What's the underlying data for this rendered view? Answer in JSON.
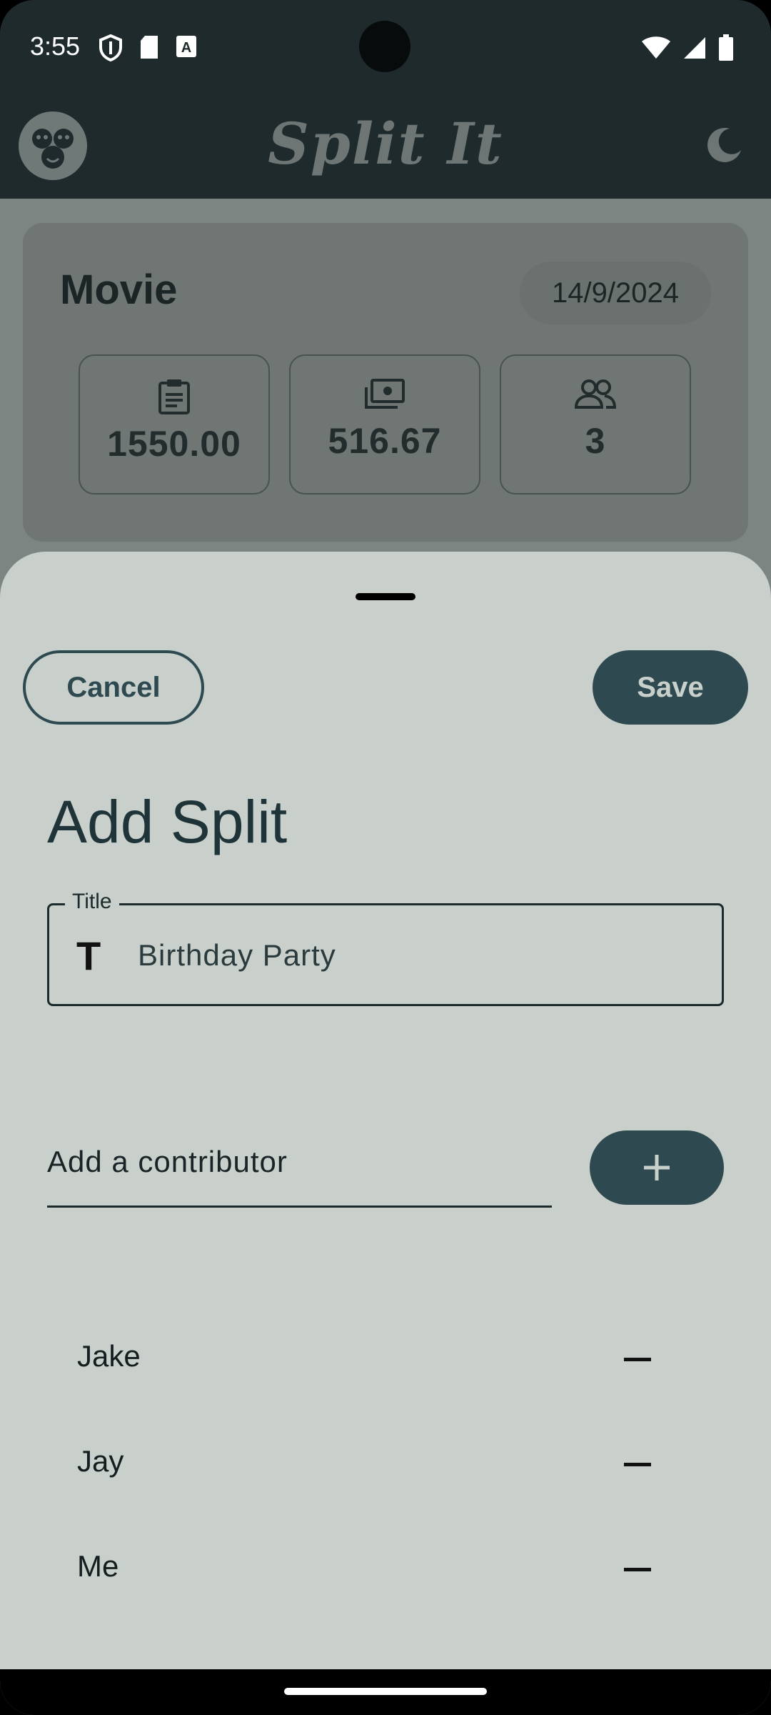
{
  "status_bar": {
    "time": "3:55"
  },
  "app_bar": {
    "title": "Split It"
  },
  "split_card": {
    "name": "Movie",
    "date": "14/9/2024",
    "stats": [
      {
        "icon": "clipboard-icon",
        "value": "1550.00"
      },
      {
        "icon": "cash-icon",
        "value": "516.67"
      },
      {
        "icon": "people-icon",
        "value": "3"
      }
    ]
  },
  "sheet": {
    "cancel_label": "Cancel",
    "save_label": "Save",
    "heading": "Add Split",
    "title_field": {
      "label": "Title",
      "icon": "T",
      "value": "Birthday Party"
    },
    "contributor_field": {
      "placeholder": "Add a contributor"
    },
    "contributors": [
      "Jake",
      "Jay",
      "Me"
    ]
  },
  "colors": {
    "primary": "#2e4a50",
    "sheet_background": "#c9d0cb",
    "app_bar": "#1e2a2c"
  }
}
